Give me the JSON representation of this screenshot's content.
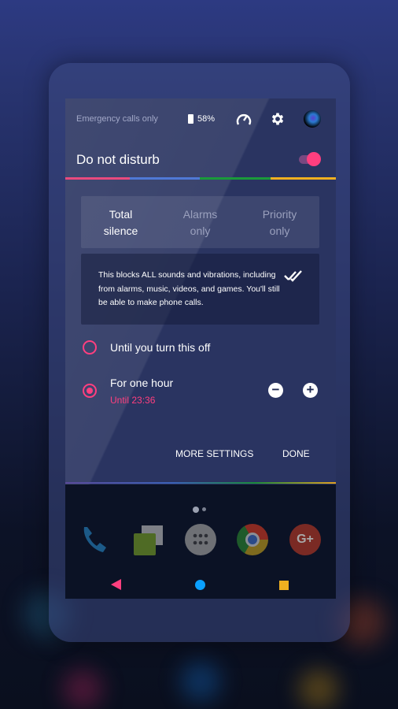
{
  "status_bar": {
    "emergency_text": "Emergency calls only",
    "battery": "58%"
  },
  "quick_settings": {
    "icons": [
      "speedometer-icon",
      "gear-icon",
      "avatar"
    ]
  },
  "dnd": {
    "title": "Do not disturb",
    "enabled": true,
    "accent": "#ff3f7f",
    "color_bar": [
      "#e94a7e",
      "#4f79d6",
      "#1a9a3a",
      "#f0b020"
    ],
    "modes": [
      {
        "line1": "Total",
        "line2": "silence",
        "selected": true
      },
      {
        "line1": "Alarms",
        "line2": "only",
        "selected": false
      },
      {
        "line1": "Priority",
        "line2": "only",
        "selected": false
      }
    ],
    "description": "This blocks ALL sounds and vibrations, including from alarms, music, videos, and games. You'll still be able to make phone calls.",
    "options": [
      {
        "label": "Until you turn this off",
        "selected": false
      },
      {
        "label": "For one hour",
        "sublabel": "Until 23:36",
        "selected": true
      }
    ],
    "more_settings": "MORE SETTINGS",
    "done": "DONE"
  },
  "dock": {
    "apps": [
      "phone-icon",
      "messenger-icon",
      "app-drawer-icon",
      "chrome-icon",
      "google-plus-icon"
    ],
    "gplus_label": "G+"
  },
  "nav": {
    "back_color": "#ff3f7f",
    "home_color": "#0aa0ff",
    "recents_color": "#f0b020"
  }
}
